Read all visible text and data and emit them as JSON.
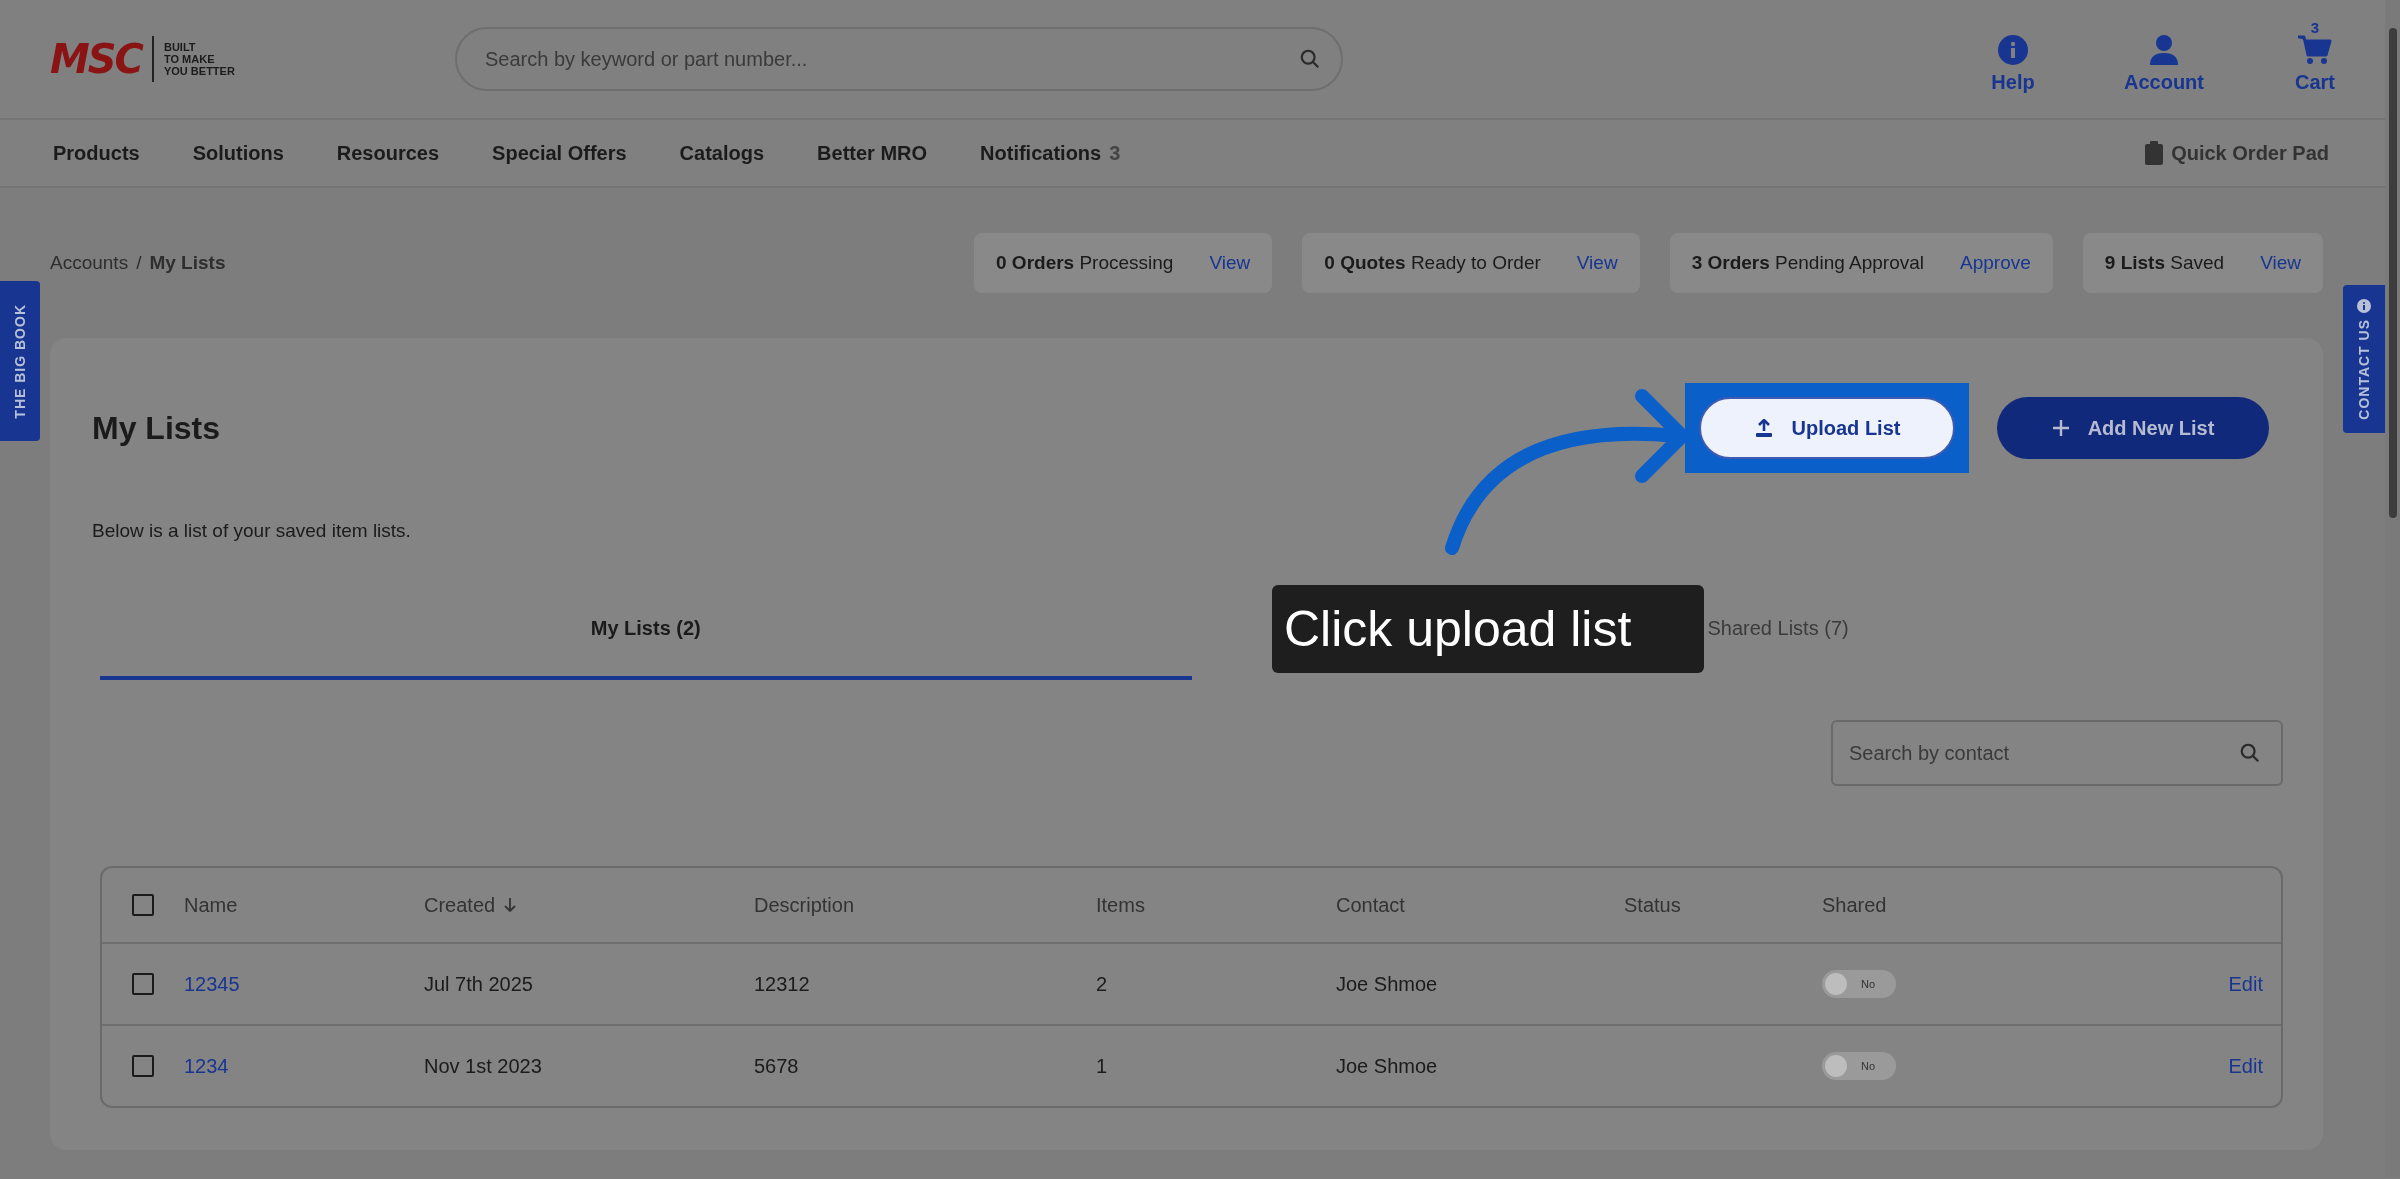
{
  "header": {
    "logo": {
      "brand": "MSC",
      "tagline": [
        "BUILT",
        "TO MAKE",
        "YOU BETTER"
      ]
    },
    "search": {
      "placeholder": "Search by keyword or part number..."
    },
    "actions": [
      {
        "kind": "help",
        "label": "Help"
      },
      {
        "kind": "account",
        "label": "Account"
      },
      {
        "kind": "cart",
        "label": "Cart",
        "badge": "3"
      }
    ]
  },
  "nav": {
    "items": [
      {
        "label": "Products"
      },
      {
        "label": "Solutions"
      },
      {
        "label": "Resources"
      },
      {
        "label": "Special Offers"
      },
      {
        "label": "Catalogs"
      },
      {
        "label": "Better MRO"
      },
      {
        "label": "Notifications",
        "badge": "3"
      }
    ],
    "quick_order": "Quick Order Pad"
  },
  "breadcrumb": {
    "items": [
      "Accounts",
      "My Lists"
    ],
    "separator": "/"
  },
  "summary": [
    {
      "count": "0 Orders",
      "label": "Processing",
      "action": "View"
    },
    {
      "count": "0 Quotes",
      "label": "Ready to Order",
      "action": "View"
    },
    {
      "count": "3 Orders",
      "label": "Pending Approval",
      "action": "Approve"
    },
    {
      "count": "9 Lists",
      "label": "Saved",
      "action": "View"
    }
  ],
  "side_tabs": {
    "left": "THE BIG BOOK",
    "right": "CONTACT US"
  },
  "page": {
    "title": "My Lists",
    "buttons": [
      {
        "kind": "upload",
        "label": "Upload List",
        "highlighted": true
      },
      {
        "kind": "add",
        "label": "Add New List",
        "highlighted": false
      }
    ],
    "description": "Below is a list of your saved item lists.",
    "tabs": [
      {
        "label": "My Lists (2)",
        "selected": true
      },
      {
        "label": "Shared Lists (7)",
        "selected": false
      }
    ],
    "search": {
      "placeholder": "Search by contact"
    },
    "table": {
      "select_all": {
        "checked": false
      },
      "columns": [
        {
          "label": "Name"
        },
        {
          "label": "Created",
          "sorted": true
        },
        {
          "label": "Description"
        },
        {
          "label": "Items"
        },
        {
          "label": "Contact"
        },
        {
          "label": "Status"
        },
        {
          "label": "Shared"
        }
      ],
      "rows": [
        {
          "checked": false,
          "name": "12345",
          "created": "Jul 7th 2025",
          "description": "12312",
          "items": "2",
          "contact": "Joe Shmoe",
          "shared": {
            "on": false,
            "label": "No"
          },
          "action": "Edit"
        },
        {
          "checked": false,
          "name": "1234",
          "created": "Nov 1st 2023",
          "description": "5678",
          "items": "1",
          "contact": "Joe Shmoe",
          "shared": {
            "on": false,
            "label": "No"
          },
          "action": "Edit"
        }
      ]
    }
  },
  "tooltip": {
    "text": "Click upload list"
  }
}
